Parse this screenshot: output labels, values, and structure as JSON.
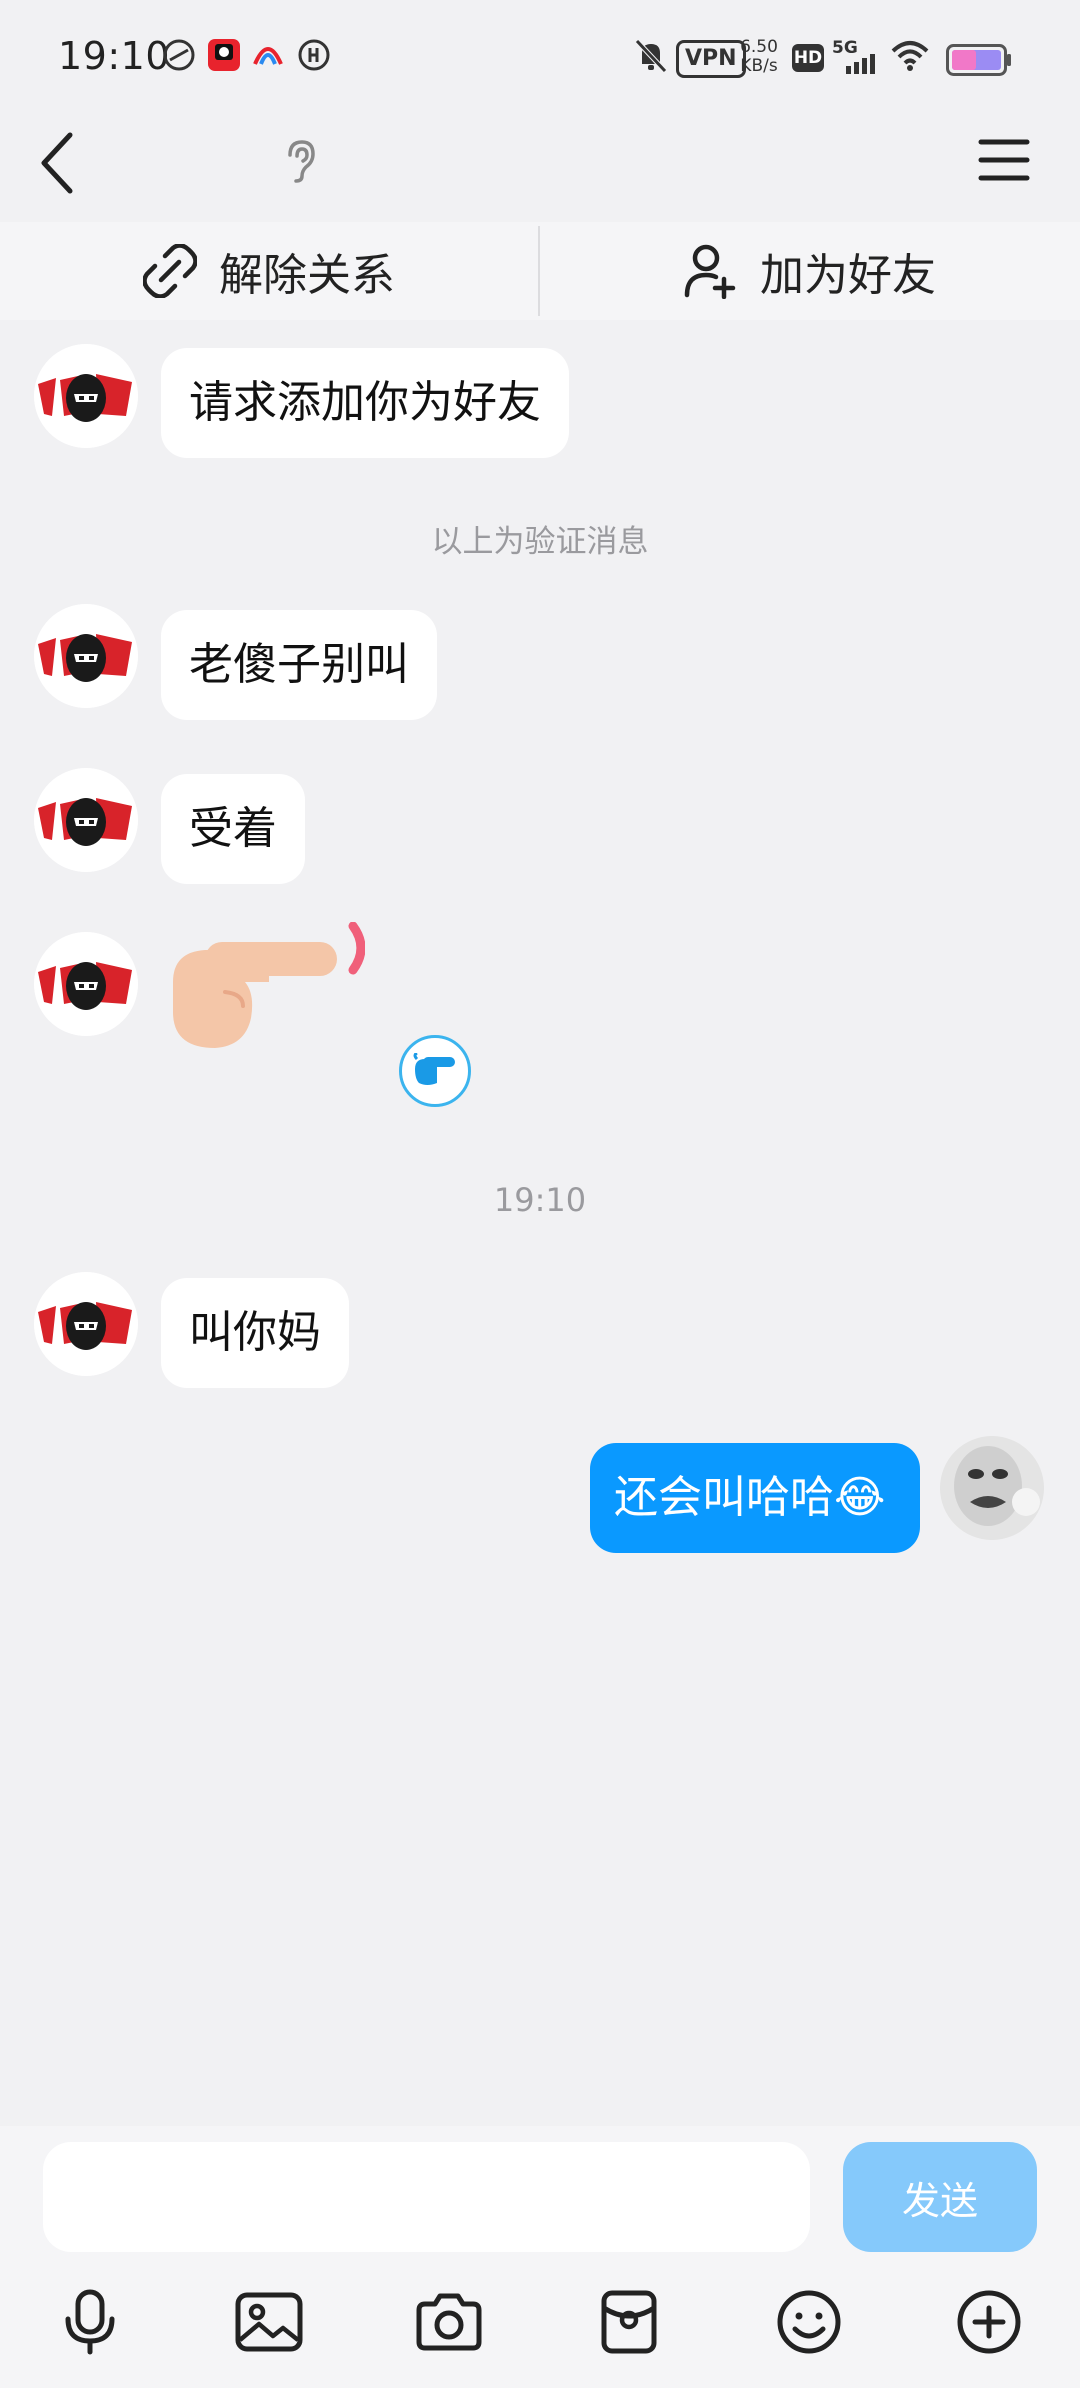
{
  "status_bar": {
    "time": "19:10",
    "vpn_label": "VPN",
    "net_speed_value": "6.50",
    "net_speed_unit": "KB/s",
    "hd_label": "HD",
    "signal_label": "5G"
  },
  "nav": {
    "back_icon": "chevron-left-icon",
    "ear_icon": "ear-icon",
    "menu_icon": "hamburger-menu-icon"
  },
  "actions": {
    "unlink_label": "解除关系",
    "add_friend_label": "加为好友"
  },
  "messages": [
    {
      "sender": "other",
      "text": "请求添加你为好友"
    },
    {
      "type": "system",
      "text": "以上为验证消息"
    },
    {
      "sender": "other",
      "text": "老傻子别叫"
    },
    {
      "sender": "other",
      "text": "受着"
    },
    {
      "sender": "other",
      "type": "sticker",
      "sticker": "pointing-finger-sticker"
    },
    {
      "type": "timestamp",
      "text": "19:10"
    },
    {
      "sender": "other",
      "text": "叫你妈"
    },
    {
      "sender": "self",
      "text": "还会叫哈哈😂"
    }
  ],
  "composer": {
    "input_value": "",
    "send_label": "发送"
  },
  "toolbar": [
    "mic-icon",
    "image-icon",
    "camera-icon",
    "red-packet-icon",
    "emoji-icon",
    "plus-icon"
  ],
  "colors": {
    "background": "#f1f1f3",
    "self_bubble": "#0a99ff",
    "send_button": "#85c9fb",
    "avatar_red": "#d8232a"
  }
}
